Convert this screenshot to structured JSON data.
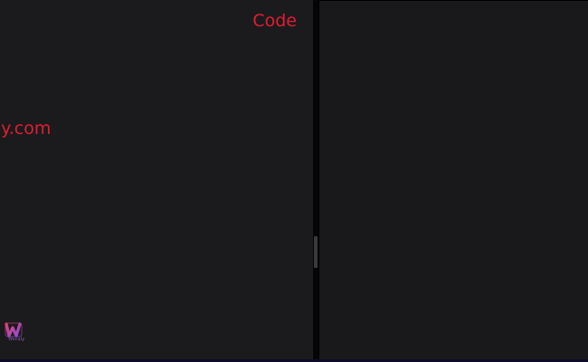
{
  "editor": {
    "code_label": "Code",
    "site_text": "echy.com"
  },
  "logo": {
    "text": "Wecaly"
  },
  "colors": {
    "accent": "#e21d32",
    "left_pane_bg": "#1b1b1d",
    "right_pane_bg": "#19191b"
  }
}
